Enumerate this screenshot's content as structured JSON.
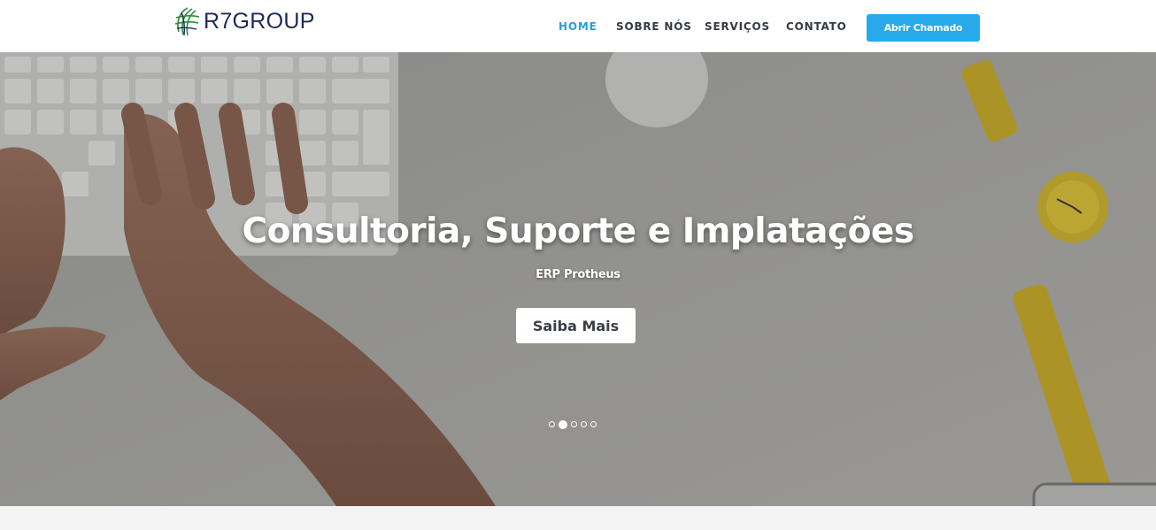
{
  "brand": {
    "name": "R7GROUP",
    "logo_icon": "globe-icon"
  },
  "nav": {
    "items": [
      {
        "label": "HOME",
        "active": true
      },
      {
        "label": "SOBRE NÓS",
        "active": false
      },
      {
        "label": "SERVIÇOS",
        "active": false
      },
      {
        "label": "CONTATO",
        "active": false
      }
    ],
    "cta_label": "Abrir Chamado"
  },
  "hero": {
    "title": "Consultoria, Suporte e Implatações",
    "subtitle": "ERP Protheus",
    "button_label": "Saiba Mais",
    "slides_total": 5,
    "active_slide": 2
  },
  "colors": {
    "accent": "#27a9ea",
    "nav_active": "#2a9fd8",
    "brand_text": "#1f2a5a"
  }
}
